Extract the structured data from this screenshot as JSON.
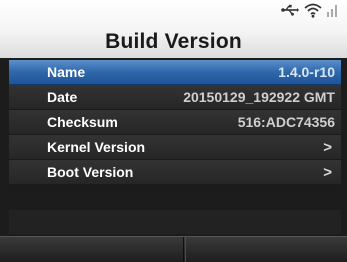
{
  "header": {
    "title": "Build Version",
    "status_icons": [
      "usb-icon",
      "wifi-icon",
      "signal-icon"
    ]
  },
  "rows": [
    {
      "label": "Name",
      "value": "1.4.0-r10",
      "selected": true
    },
    {
      "label": "Date",
      "value": "20150129_192922 GMT"
    },
    {
      "label": "Checksum",
      "value": "516:ADC74356"
    },
    {
      "label": "Kernel Version",
      "chevron": ">"
    },
    {
      "label": "Boot Version",
      "chevron": ">"
    }
  ],
  "colors": {
    "selected_row": "#2f67ab",
    "background": "#1c1c1c",
    "header": "#ffffff"
  }
}
